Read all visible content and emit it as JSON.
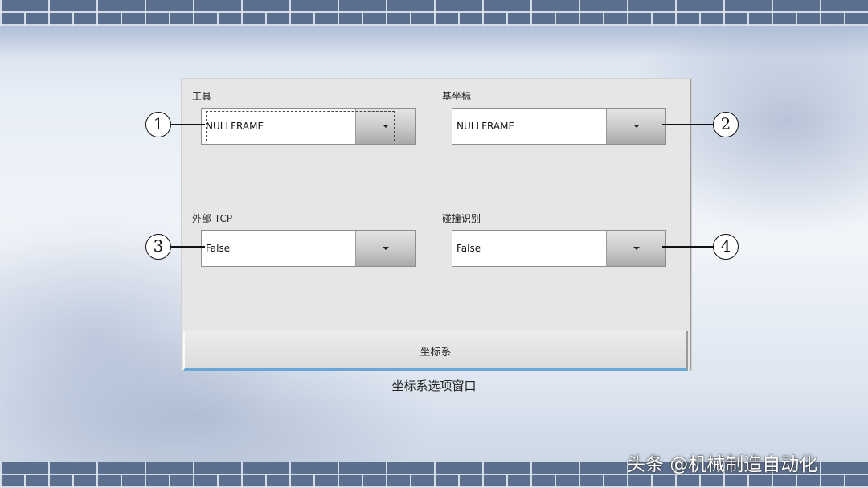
{
  "dialog": {
    "fields": [
      {
        "label": "工具",
        "value": "NULLFRAME",
        "callout": "1"
      },
      {
        "label": "基坐标",
        "value": "NULLFRAME",
        "callout": "2"
      },
      {
        "label": "外部 TCP",
        "value": "False",
        "callout": "3"
      },
      {
        "label": "碰撞识别",
        "value": "False",
        "callout": "4"
      }
    ],
    "tab_label": "坐标系"
  },
  "caption": "坐标系选项窗口",
  "watermark": "头条 @机械制造自动化",
  "colors": {
    "brick": "#5d6f8f",
    "dialog_bg": "#e6e6e6",
    "tab_accent": "#6aa6d8"
  },
  "icons": {
    "dropdown": "chevron-down-icon"
  }
}
